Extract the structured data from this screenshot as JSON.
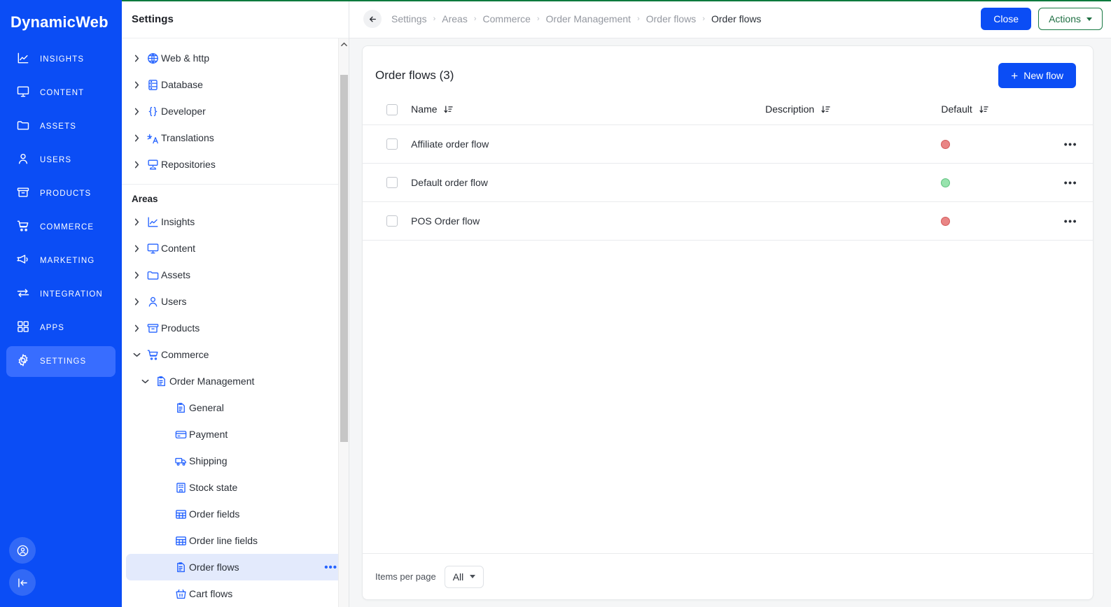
{
  "brand": {
    "name": "DynamicWeb"
  },
  "primary_nav": {
    "items": [
      {
        "label": "INSIGHTS",
        "icon": "insights-icon",
        "active": false
      },
      {
        "label": "CONTENT",
        "icon": "content-icon",
        "active": false
      },
      {
        "label": "ASSETS",
        "icon": "assets-icon",
        "active": false
      },
      {
        "label": "USERS",
        "icon": "users-icon",
        "active": false
      },
      {
        "label": "PRODUCTS",
        "icon": "products-icon",
        "active": false
      },
      {
        "label": "COMMERCE",
        "icon": "commerce-icon",
        "active": false
      },
      {
        "label": "MARKETING",
        "icon": "marketing-icon",
        "active": false
      },
      {
        "label": "INTEGRATION",
        "icon": "integration-icon",
        "active": false
      },
      {
        "label": "APPS",
        "icon": "apps-icon",
        "active": false
      },
      {
        "label": "SETTINGS",
        "icon": "settings-icon",
        "active": true
      }
    ],
    "bottom": [
      {
        "icon": "account-icon"
      },
      {
        "icon": "collapse-sidebar-icon"
      }
    ]
  },
  "tree": {
    "title": "Settings",
    "section_label": "Areas",
    "top_items": [
      {
        "label": "Web & http",
        "icon": "globe-icon",
        "expandable": true,
        "expanded": false,
        "indent": 0
      },
      {
        "label": "Database",
        "icon": "database-icon",
        "expandable": true,
        "expanded": false,
        "indent": 0
      },
      {
        "label": "Developer",
        "icon": "braces-icon",
        "expandable": true,
        "expanded": false,
        "indent": 0
      },
      {
        "label": "Translations",
        "icon": "translate-icon",
        "expandable": true,
        "expanded": false,
        "indent": 0
      },
      {
        "label": "Repositories",
        "icon": "repository-icon",
        "expandable": true,
        "expanded": false,
        "indent": 0
      }
    ],
    "area_items": [
      {
        "label": "Insights",
        "icon": "insights-icon",
        "expandable": true,
        "expanded": false,
        "indent": 0,
        "selected": false
      },
      {
        "label": "Content",
        "icon": "content-icon",
        "expandable": true,
        "expanded": false,
        "indent": 0,
        "selected": false
      },
      {
        "label": "Assets",
        "icon": "assets-icon",
        "expandable": true,
        "expanded": false,
        "indent": 0,
        "selected": false
      },
      {
        "label": "Users",
        "icon": "users-icon",
        "expandable": true,
        "expanded": false,
        "indent": 0,
        "selected": false
      },
      {
        "label": "Products",
        "icon": "products-icon",
        "expandable": true,
        "expanded": false,
        "indent": 0,
        "selected": false
      },
      {
        "label": "Commerce",
        "icon": "commerce-icon",
        "expandable": true,
        "expanded": true,
        "indent": 0,
        "selected": false
      },
      {
        "label": "Order Management",
        "icon": "order-doc-icon",
        "expandable": true,
        "expanded": true,
        "indent": 1,
        "selected": false
      },
      {
        "label": "General",
        "icon": "order-doc-icon",
        "expandable": false,
        "expanded": false,
        "indent": 2,
        "selected": false
      },
      {
        "label": "Payment",
        "icon": "card-icon",
        "expandable": false,
        "expanded": false,
        "indent": 2,
        "selected": false
      },
      {
        "label": "Shipping",
        "icon": "truck-icon",
        "expandable": false,
        "expanded": false,
        "indent": 2,
        "selected": false
      },
      {
        "label": "Stock state",
        "icon": "warehouse-icon",
        "expandable": false,
        "expanded": false,
        "indent": 2,
        "selected": false
      },
      {
        "label": "Order fields",
        "icon": "table-icon",
        "expandable": false,
        "expanded": false,
        "indent": 2,
        "selected": false
      },
      {
        "label": "Order line fields",
        "icon": "table-icon",
        "expandable": false,
        "expanded": false,
        "indent": 2,
        "selected": false
      },
      {
        "label": "Order flows",
        "icon": "order-doc-icon",
        "expandable": false,
        "expanded": false,
        "indent": 2,
        "selected": true,
        "dots": "•••"
      },
      {
        "label": "Cart flows",
        "icon": "basket-icon",
        "expandable": false,
        "expanded": false,
        "indent": 2,
        "selected": false
      }
    ]
  },
  "topbar": {
    "back_icon": "back-arrow-icon",
    "breadcrumb": [
      "Settings",
      "Areas",
      "Commerce",
      "Order Management",
      "Order flows",
      "Order flows"
    ],
    "separator": "›",
    "close_label": "Close",
    "actions_label": "Actions"
  },
  "main": {
    "card_title": "Order flows (3)",
    "new_flow_label": "New flow",
    "new_flow_plus": "+",
    "columns": [
      {
        "label": "Name",
        "sortable": true
      },
      {
        "label": "Description",
        "sortable": true
      },
      {
        "label": "Default",
        "sortable": true
      }
    ],
    "rows": [
      {
        "name": "Affiliate order flow",
        "description": "",
        "default": false,
        "checked": false,
        "dots": "•••"
      },
      {
        "name": "Default order flow",
        "description": "",
        "default": true,
        "checked": false,
        "dots": "•••"
      },
      {
        "name": "POS Order flow",
        "description": "",
        "default": false,
        "checked": false,
        "dots": "•••"
      }
    ],
    "footer": {
      "items_per_page_label": "Items per page",
      "items_per_page_value": "All"
    }
  },
  "colors": {
    "brand_blue": "#0b4df5",
    "accent_green": "#1a7a45",
    "top_rule_green": "#0a7a3d",
    "status_false": "#e98585",
    "status_true": "#97e3ad",
    "selected_tree": "#e3eafc"
  }
}
